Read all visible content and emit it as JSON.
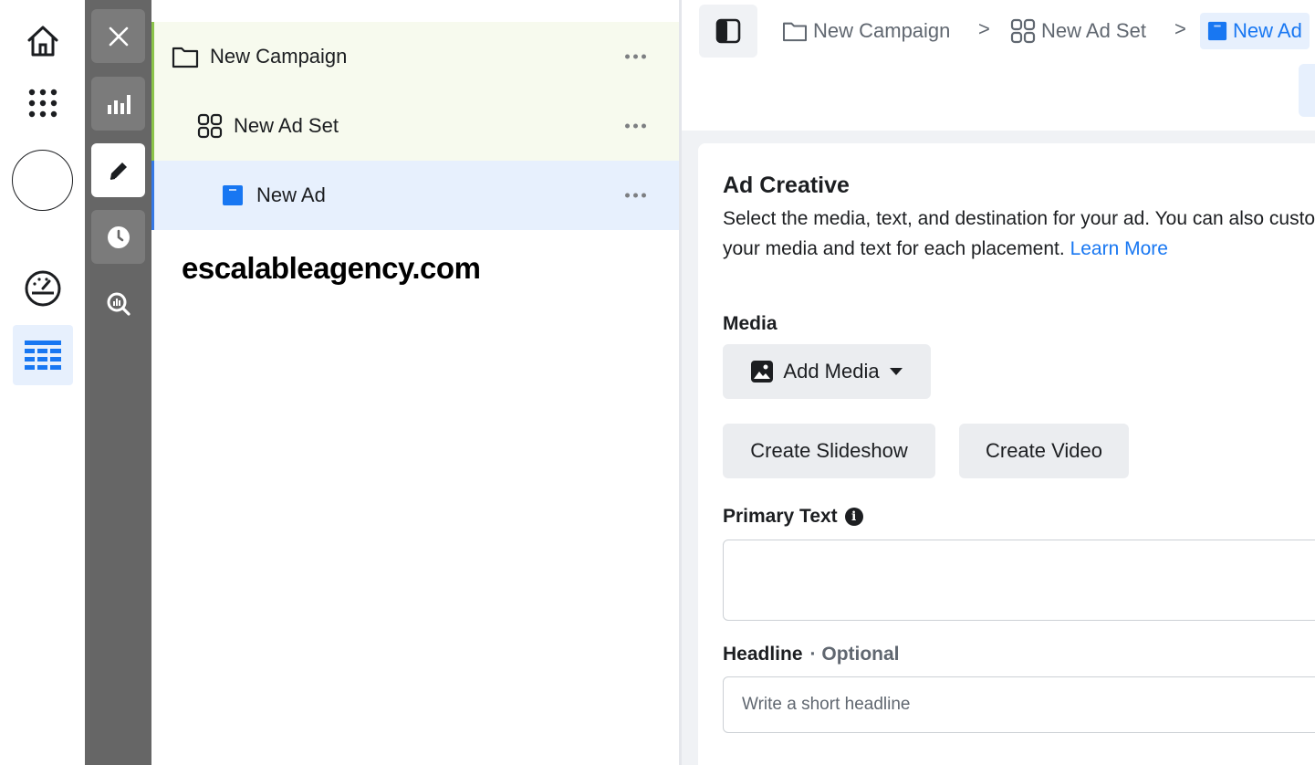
{
  "tree": {
    "campaign": {
      "label": "New Campaign"
    },
    "ad_set": {
      "label": "New Ad Set"
    },
    "ad": {
      "label": "New Ad"
    },
    "watermark": "escalableagency.com"
  },
  "breadcrumb": {
    "campaign": "New Campaign",
    "ad_set": "New Ad Set",
    "ad": "New Ad",
    "separator": ">"
  },
  "ad_creative": {
    "title": "Ad Creative",
    "description": "Select the media, text, and destination for your ad. You can also customize your media and text for each placement.",
    "learn_more": "Learn More",
    "media_label": "Media",
    "add_media_label": "Add Media",
    "create_slideshow_label": "Create Slideshow",
    "create_video_label": "Create Video",
    "primary_text_label": "Primary Text",
    "headline_label": "Headline",
    "headline_optional": "· Optional",
    "headline_placeholder": "Write a short headline"
  },
  "colors": {
    "accent_blue": "#1877f2",
    "campaign_green": "#8bc34a",
    "tool_strip": "#666666"
  }
}
